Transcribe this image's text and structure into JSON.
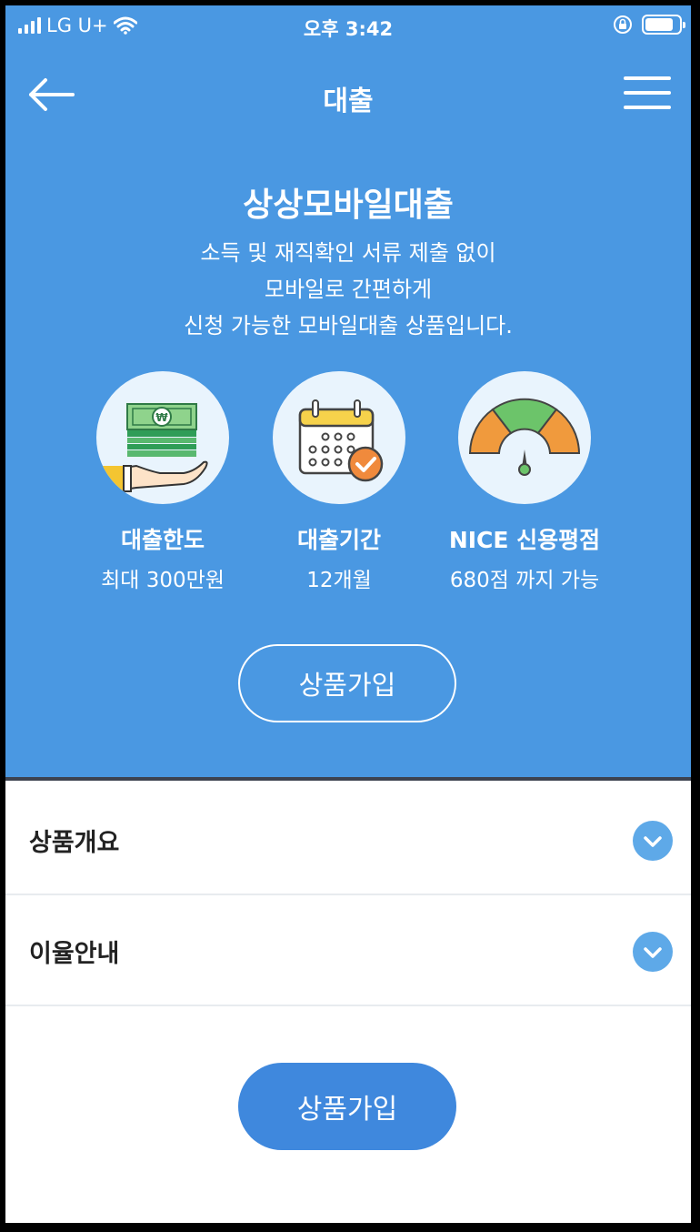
{
  "status_bar": {
    "carrier": "LG U+",
    "time": "오후 3:42"
  },
  "navbar": {
    "title": "대출",
    "back_icon": "arrow-left-icon",
    "menu_icon": "hamburger-menu-icon"
  },
  "hero": {
    "title": "상상모바일대출",
    "description_lines": [
      "소득 및 재직확인 서류 제출 없이",
      "모바일로 간편하게",
      "신청 가능한 모바일대출 상품입니다."
    ],
    "features": [
      {
        "icon": "money-hand-icon",
        "label": "대출한도",
        "value": "최대 300만원"
      },
      {
        "icon": "calendar-check-icon",
        "label": "대출기간",
        "value": "12개월"
      },
      {
        "icon": "credit-gauge-icon",
        "label": "NICE 신용평점",
        "value": "680점 까지 가능"
      }
    ],
    "join_button": "상품가입"
  },
  "accordion": [
    {
      "label": "상품개요",
      "icon": "chevron-down-icon"
    },
    {
      "label": "이율안내",
      "icon": "chevron-down-icon"
    }
  ],
  "bottom_join_button": "상품가입",
  "colors": {
    "hero_bg": "#4a98e2",
    "primary_button": "#3f88dd",
    "chevron_bg": "#5ea9e8"
  }
}
